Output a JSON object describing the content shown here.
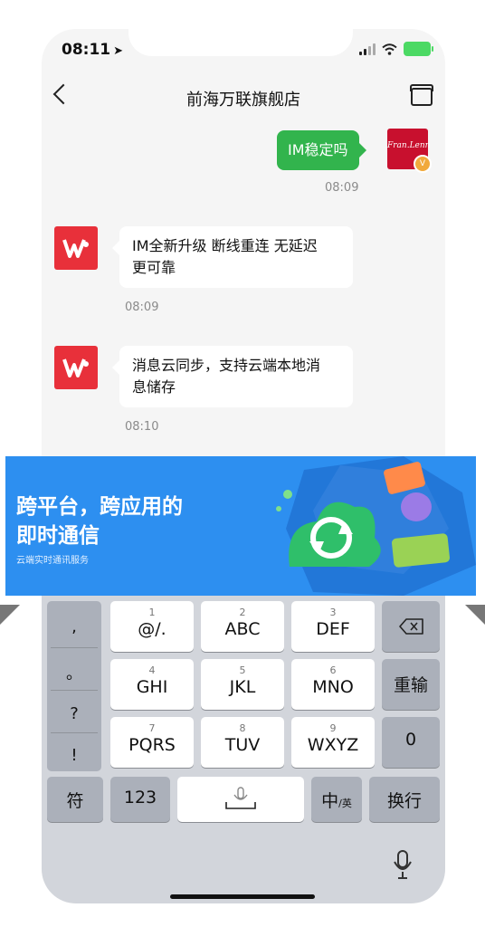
{
  "status": {
    "time": "08:11"
  },
  "nav": {
    "title": "前海万联旗舰店"
  },
  "messages": [
    {
      "side": "right",
      "text": "IM稳定吗",
      "time": "08:09"
    },
    {
      "side": "left",
      "line1": "IM全新升级 断线重连 无延迟",
      "line2": "更可靠",
      "time": "08:09"
    },
    {
      "side": "left",
      "line1": "消息云同步，支持云端本地消",
      "line2": "息储存",
      "time": "08:10"
    }
  ],
  "store_avatar_text": "Fran.Lenn",
  "verified_badge": "V",
  "banner": {
    "title_line1": "跨平台，跨应用的",
    "title_line2": "即时通信",
    "subtitle": "云端实时通讯服务"
  },
  "keyboard": {
    "punct": [
      ",",
      "。",
      "?",
      "!"
    ],
    "rows": [
      [
        {
          "num": "1",
          "label": "@/."
        },
        {
          "num": "2",
          "label": "ABC"
        },
        {
          "num": "3",
          "label": "DEF"
        }
      ],
      [
        {
          "num": "4",
          "label": "GHI"
        },
        {
          "num": "5",
          "label": "JKL"
        },
        {
          "num": "6",
          "label": "MNO"
        }
      ],
      [
        {
          "num": "7",
          "label": "PQRS"
        },
        {
          "num": "8",
          "label": "TUV"
        },
        {
          "num": "9",
          "label": "WXYZ"
        }
      ]
    ],
    "reenter": "重输",
    "zero": "0",
    "symbols": "符",
    "numbers": "123",
    "lang_main": "中",
    "lang_sub": "/英",
    "enter": "换行"
  },
  "icons": [
    "location-arrow-icon",
    "signal-icon",
    "wifi-icon",
    "battery-icon",
    "back-icon",
    "store-icon",
    "backspace-icon",
    "microphone-icon",
    "sync-icon"
  ],
  "colors": {
    "sent_bubble": "#32b44d",
    "banner": "#2d8ff0",
    "avatar_red": "#e8303a"
  }
}
